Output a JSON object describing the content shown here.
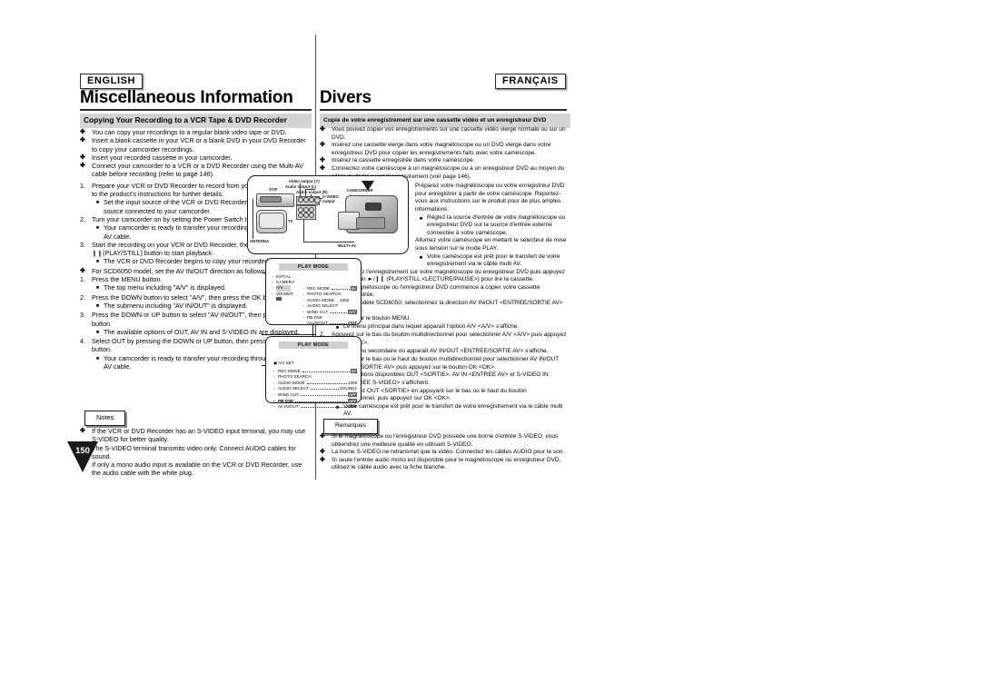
{
  "page": {
    "number": "150",
    "languages": {
      "english": "ENGLISH",
      "french": "FRANÇAIS"
    }
  },
  "english": {
    "title": "Miscellaneous Information",
    "subheading": "Copying Your Recording to a VCR Tape & DVD Recorder",
    "bullets": [
      "You can copy your recordings to a regular blank video tape or DVD.",
      "Insert a blank cassette in your VCR or a blank DVD in your DVD Recorder to copy your camcorder recordings.",
      "Insert your recorded cassette in your camcorder.",
      "Connect your camcorder to a VCR or a DVD Recorder using the Multi-AV cable before recording (refer to page 146)."
    ],
    "steps": [
      {
        "num": "1.",
        "text": "Prepare your VCR or DVD Recorder to record from your camcorder. Refer to the product's instructions for further details.",
        "sub": [
          "Set the input source of the VCR or DVD Recorder to the external input source connected to your camcorder."
        ]
      },
      {
        "num": "2.",
        "text": "Turn your camcorder on by setting the Power Switch to PLAY mode.",
        "sub": [
          "Your camcorder is ready to transfer your recording through the Multi-AV cable."
        ]
      },
      {
        "num": "3.",
        "text": "Start the recording on your VCR or DVD Recorder, then press the ►/❙❙(PLAY/STILL) button to start playback.",
        "sub": [
          "The VCR or DVD Recorder begins to copy your recorded cassette."
        ]
      }
    ],
    "model_note": "For SCD6050 model, set the AV IN/OUT direction as follows:",
    "steps2": [
      {
        "num": "1.",
        "text": "Press the MENU button.",
        "sub": [
          "The top menu including \"A/V\" is displayed."
        ]
      },
      {
        "num": "2.",
        "text": "Press the DOWN button to select \"A/V\", then press the OK button.",
        "sub": [
          "The submenu including \"AV IN/OUT\" is displayed."
        ]
      },
      {
        "num": "3.",
        "text": "Press the DOWN or UP button to select \"AV IN/OUT\", then press the OK button.",
        "sub": [
          "The available options of OUT, AV IN and S-VIDEO IN are displayed."
        ]
      },
      {
        "num": "4.",
        "text": "Select OUT by pressing the DOWN or UP button, then press the OK button.",
        "sub": [
          "Your camcorder is ready to transfer your recording through the Multi-AV cable."
        ]
      }
    ],
    "notes_label": "Notes",
    "notes": [
      "If the VCR or DVD Recorder has an S-VIDEO input terminal, you may use S-VIDEO for better quality.",
      "The S-VIDEO terminal transmits video only. Connect AUDIO cables for sound.",
      "If only a mono audio input is available on the VCR or DVD Recorder, use the audio cable with the white plug."
    ]
  },
  "french": {
    "title": "Divers",
    "subheading": "Copie de votre enregistrement sur une cassette vidéo et un enregistreur DVD",
    "bullets": [
      "Vous pouvez copier vos enregistrements sur une cassette vidéo vierge normale ou sur un DVD.",
      "Insérez une cassette vierge dans votre magnétoscope ou un DVD vierge dans votre enregistreur DVD pour copier les enregistrements faits avec votre caméscope.",
      "Insérez la cassette enregistrée dans votre caméscope.",
      "Connectez votre caméscope à un magnétoscope ou à un enregistreur DVD au moyen du câble multi AV avant l'enregistrement (voir page 146)."
    ],
    "steps": [
      {
        "num": "1.",
        "text": "Préparez votre magnétoscope ou votre enregistreur DVD pour enregistrer à partir de votre caméscope. Reportez-vous aux instructions sur le produit pour de plus amples informations.",
        "sub": [
          "Réglez la source d'entrée de votre magnétoscope ou enregistreur DVD sur la source d'entrée externe connectée à votre caméscope."
        ]
      },
      {
        "num": "2.",
        "text": "Allumez votre caméscope en mettant le sélecteur de mise sous tension sur le mode PLAY.",
        "sub": [
          "Votre caméscope est prêt pour le transfert de votre enregistrement via le câble multi AV."
        ]
      },
      {
        "num": "3.",
        "text": "Commencez l'enregistrement sur votre magnétoscope ou enregistreur DVD puis appuyez sur le bouton ►/❙❙ (PLAY/STILL <LECTURE/PAUSE>) pour lire la cassette.",
        "sub": [
          "Le magnétoscope ou l'enregistreur DVD commence à copier votre cassette enregistrée."
        ]
      }
    ],
    "model_note": "Pour les modèle SCD6050, sélectionnez la direction AV IN/OUT <ENTREE/SORTIE AV> comme suit:",
    "steps2": [
      {
        "num": "1.",
        "text": "Appuyez sur le bouton MENU.",
        "sub": [
          "Le menu principal dans lequel apparaît l'option A/V <A/V> s'affiche."
        ]
      },
      {
        "num": "2.",
        "text": "Appuyez sur le bas du bouton multidirectionnel pour sélectionner A/V <A/V> puis appuyez sur OK <OK>.",
        "sub": [
          "Le menu secondaire où apparaît AV IN/OUT <ENTREE/SORTIE AV> s'affiche."
        ]
      },
      {
        "num": "3.",
        "text": "Appuyez sur le bas ou le haut du bouton multidirectionnel pour sélectionner AV IN/OUT <ENTREE/SORTIE AV> puis appuyez sur le bouton OK <OK>.",
        "sub": [
          "Les options disponibles OUT <SORTIE>, AV IN <ENTREE AV> et S-VIDEO IN <ENTREE S-VIDEO> s'affichent."
        ]
      },
      {
        "num": "4.",
        "text": "Sélectionnez OUT <SORTIE> en appuyant sur le bas ou le haut du bouton multidirectionnel, puis appuyez sur OK <OK>.",
        "sub": [
          "Votre caméscope est prêt pour le transfert de votre enregistrement via le câble multi AV."
        ]
      }
    ],
    "notes_label": "Remarques",
    "notes": [
      "Si le magnétoscope ou l'enregistreur DVD possède une borne d'entrée S-VIDEO, vous obtiendrez une meilleure qualité en utilisant S-VIDEO.",
      "La borne S-VIDEO ne retransmet que la vidéo. Connectez les câbles AUDIO pour le son.",
      "Si seule l'entrée audio mono est disponible pour le magnétoscope ou enregistreur DVD, utilisez le câble audio avec la fiche blanche."
    ]
  },
  "diagram": {
    "labels": {
      "vcr": "VCR",
      "tv": "TV",
      "antenna": "ANTENNA",
      "camcorder": "CAMCORDER",
      "multi_av": "MULTI-AV",
      "video_output": "Video output (Y)",
      "audio_output_l": "Audio output (L)",
      "audio_output_r": "Audio output (R)",
      "svideo_output": "S-VIDEO output"
    }
  },
  "osd_menus": [
    {
      "title": "PLAY MODE",
      "left_items": [
        "INITIAL",
        "CAMERA",
        "A/V",
        "VIEWER"
      ],
      "selected_left": "A/V",
      "right_items": [
        {
          "label": "REC MODE",
          "value": "SP"
        },
        {
          "label": "PHOTO SEARCH",
          "value": ""
        },
        {
          "label": "AUDIO MODE",
          "value": "12bit"
        },
        {
          "label": "AUDIO SELECT",
          "value": ""
        },
        {
          "label": "WIND CUT",
          "value": "OFF"
        },
        {
          "label": "PB DSE",
          "value": ""
        },
        {
          "label": "AV IN/OUT",
          "value": "OUT"
        }
      ]
    },
    {
      "title": "PLAY MODE",
      "subheading": "A/V SET",
      "items": [
        {
          "label": "REC MODE",
          "value": "SP"
        },
        {
          "label": "PHOTO SEARCH",
          "value": ""
        },
        {
          "label": "AUDIO MODE",
          "value": "12bit"
        },
        {
          "label": "AUDIO SELECT",
          "value": "SOUND1"
        },
        {
          "label": "WIND CUT",
          "value": "OFF"
        },
        {
          "label": "PB DSE",
          "value": "OFF"
        },
        {
          "label": "AV IN/OUT",
          "value": "OUT"
        }
      ]
    }
  ]
}
